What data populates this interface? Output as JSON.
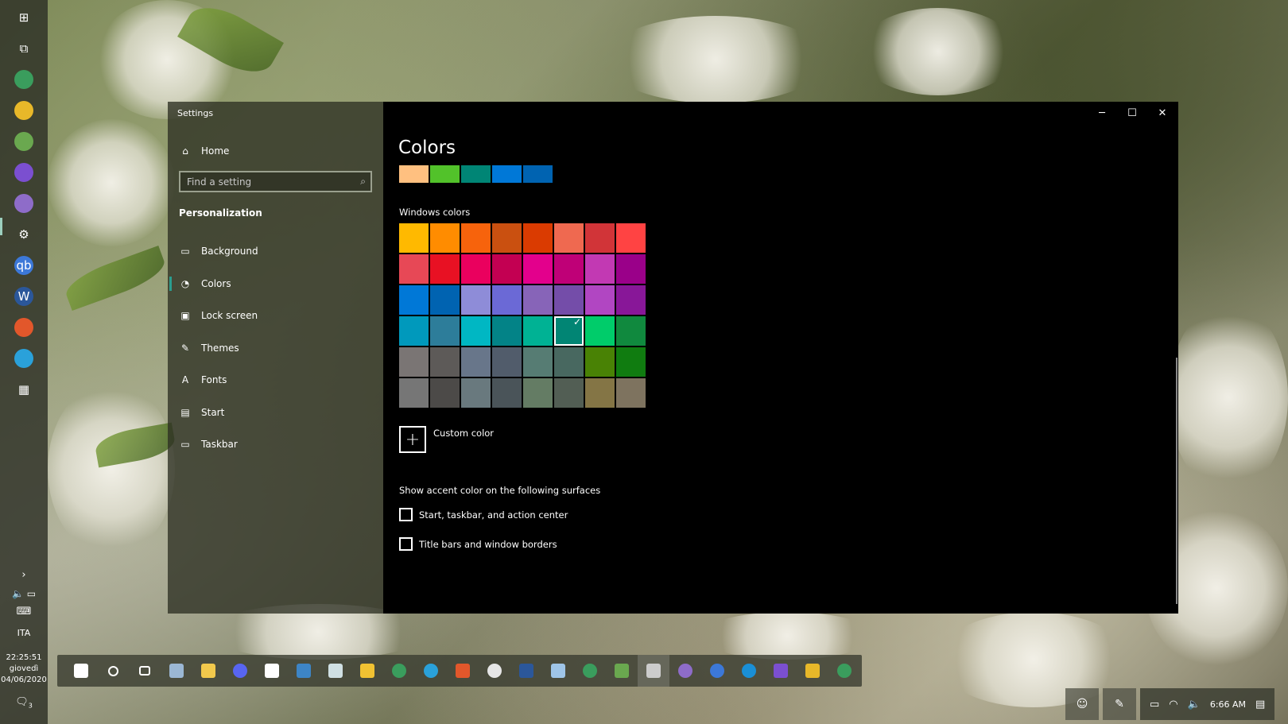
{
  "window": {
    "title": "Settings",
    "controls": {
      "minimize": "─",
      "maximize": "☐",
      "close": "✕"
    }
  },
  "sidebar": {
    "home": "Home",
    "search_placeholder": "Find a setting",
    "section": "Personalization",
    "items": [
      {
        "label": "Background",
        "icon": "image-icon",
        "glyph": "▭"
      },
      {
        "label": "Colors",
        "icon": "palette-icon",
        "glyph": "◔"
      },
      {
        "label": "Lock screen",
        "icon": "lock-screen-icon",
        "glyph": "▣"
      },
      {
        "label": "Themes",
        "icon": "themes-icon",
        "glyph": "✎"
      },
      {
        "label": "Fonts",
        "icon": "fonts-icon",
        "glyph": "A"
      },
      {
        "label": "Start",
        "icon": "start-icon",
        "glyph": "▤"
      },
      {
        "label": "Taskbar",
        "icon": "taskbar-icon",
        "glyph": "▭"
      }
    ],
    "selected_index": 1
  },
  "main": {
    "title": "Colors",
    "recent_colors": [
      "#ffc080",
      "#52c22a",
      "#008575",
      "#0078d7",
      "#0063b1"
    ],
    "windows_colors_label": "Windows colors",
    "palette": [
      [
        "#ffb900",
        "#ff8c00",
        "#f7630c",
        "#ca5010",
        "#da3b01",
        "#ef6950",
        "#d13438",
        "#ff4343"
      ],
      [
        "#e74856",
        "#e81123",
        "#ea005e",
        "#c30052",
        "#e3008c",
        "#bf0077",
        "#c239b3",
        "#9a0089"
      ],
      [
        "#0078d7",
        "#0063b1",
        "#8e8cd8",
        "#6b69d6",
        "#8764b8",
        "#744da9",
        "#b146c2",
        "#881798"
      ],
      [
        "#0099bc",
        "#2d7d9a",
        "#00b7c3",
        "#038387",
        "#00b294",
        "#018574",
        "#00cc6a",
        "#10893e"
      ],
      [
        "#7a7574",
        "#5d5a58",
        "#68768a",
        "#515c6b",
        "#567c73",
        "#486860",
        "#498205",
        "#107c10"
      ],
      [
        "#767676",
        "#4c4a48",
        "#69797e",
        "#4a5459",
        "#647c64",
        "#525e54",
        "#847545",
        "#7e735f"
      ]
    ],
    "selected_color": "#018574",
    "custom_color_label": "Custom color",
    "surfaces_label": "Show accent color on the following surfaces",
    "checkbox_start": "Start, taskbar, and action center",
    "checkbox_titlebars": "Title bars and window borders"
  },
  "left_taskbar": {
    "time": "22:25:51",
    "day": "giovedì",
    "date": "04/06/2020",
    "lang": "ITA",
    "notifications": "3",
    "icons": [
      {
        "name": "windows-start-icon",
        "glyph": "⊞",
        "color": "transparent"
      },
      {
        "name": "task-view-icon",
        "glyph": "⧉",
        "color": "transparent"
      },
      {
        "name": "edge-canary-icon",
        "glyph": "",
        "color": "#3a9d5d"
      },
      {
        "name": "file-explorer-icon",
        "glyph": "",
        "color": "#e8b829"
      },
      {
        "name": "notepad-icon",
        "glyph": "",
        "color": "#6aa84f"
      },
      {
        "name": "visual-studio-icon",
        "glyph": "",
        "color": "#7b4fd0"
      },
      {
        "name": "chat-app-icon",
        "glyph": "",
        "color": "#8e6cc9"
      },
      {
        "name": "settings-gear-icon",
        "glyph": "⚙",
        "color": "transparent"
      },
      {
        "name": "qbittorrent-icon",
        "glyph": "qb",
        "color": "#3c78d8"
      },
      {
        "name": "word-icon",
        "glyph": "W",
        "color": "#2b579a"
      },
      {
        "name": "brave-icon",
        "glyph": "",
        "color": "#e2572b"
      },
      {
        "name": "telegram-icon",
        "glyph": "",
        "color": "#2aa1da"
      },
      {
        "name": "widgets-icon",
        "glyph": "▦",
        "color": "transparent"
      }
    ]
  },
  "bottom_taskbar": {
    "icons": [
      {
        "name": "start-icon",
        "color": "#ffffff"
      },
      {
        "name": "search-icon",
        "color": "transparent"
      },
      {
        "name": "task-view-icon",
        "color": "transparent"
      },
      {
        "name": "photos-icon",
        "color": "#9bb7d4"
      },
      {
        "name": "folder-icon",
        "color": "#f2c94c"
      },
      {
        "name": "discord-icon",
        "color": "#5865f2"
      },
      {
        "name": "widgets-icon",
        "color": "#ffffff"
      },
      {
        "name": "window-app-icon",
        "color": "#3d85c6"
      },
      {
        "name": "window-app2-icon",
        "color": "#d0e0e3"
      },
      {
        "name": "notes-icon",
        "color": "#f1c232"
      },
      {
        "name": "edge-canary-icon",
        "color": "#3a9d5d"
      },
      {
        "name": "telegram-icon",
        "color": "#2aa1da"
      },
      {
        "name": "brave-icon",
        "color": "#e2572b"
      },
      {
        "name": "clock-app-icon",
        "color": "#e6e6e6"
      },
      {
        "name": "word-icon",
        "color": "#2b579a"
      },
      {
        "name": "files-icon",
        "color": "#9fc5e8"
      },
      {
        "name": "edge-canary2-icon",
        "color": "#3a9d5d"
      },
      {
        "name": "notepad-icon",
        "color": "#6aa84f"
      },
      {
        "name": "settings-gear-icon",
        "color": "#cccccc"
      },
      {
        "name": "chat-app-icon",
        "color": "#8e6cc9"
      },
      {
        "name": "qbittorrent-icon",
        "color": "#3c78d8"
      },
      {
        "name": "edge-icon",
        "color": "#1a8fd6"
      },
      {
        "name": "visual-studio-icon",
        "color": "#7b4fd0"
      },
      {
        "name": "file-explorer-icon",
        "color": "#e8b829"
      },
      {
        "name": "edge-canary3-icon",
        "color": "#3a9d5d"
      }
    ],
    "active_index": 18
  },
  "system_tray": {
    "time": "6:66 AM"
  }
}
